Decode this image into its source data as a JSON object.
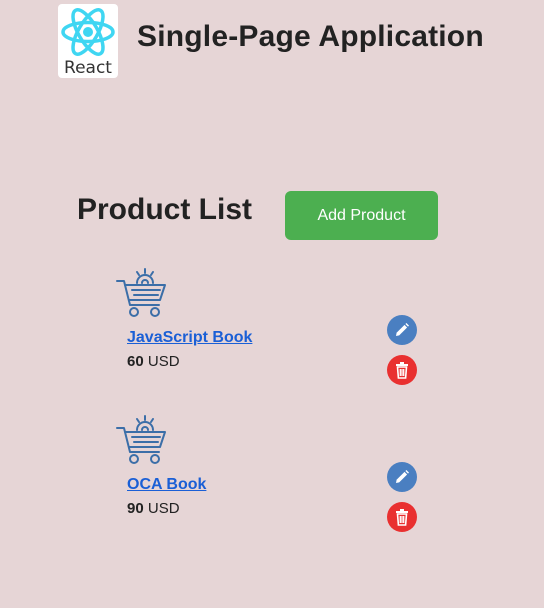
{
  "header": {
    "logo_text": "React",
    "title": "Single-Page Application"
  },
  "main": {
    "title": "Product List",
    "add_button_label": "Add Product"
  },
  "products": [
    {
      "name": "JavaScript Book",
      "price": "60",
      "currency": "USD"
    },
    {
      "name": "OCA Book",
      "price": "90",
      "currency": "USD"
    }
  ],
  "icons": {
    "logo": "react-atom-icon",
    "product": "shopping-cart-gear-icon",
    "edit": "pencil-icon",
    "delete": "trash-icon"
  },
  "colors": {
    "background": "#e6d5d6",
    "add_button": "#4caf50",
    "edit_button": "#4a7fc1",
    "delete_button": "#e93030",
    "link": "#1a5fd6"
  }
}
